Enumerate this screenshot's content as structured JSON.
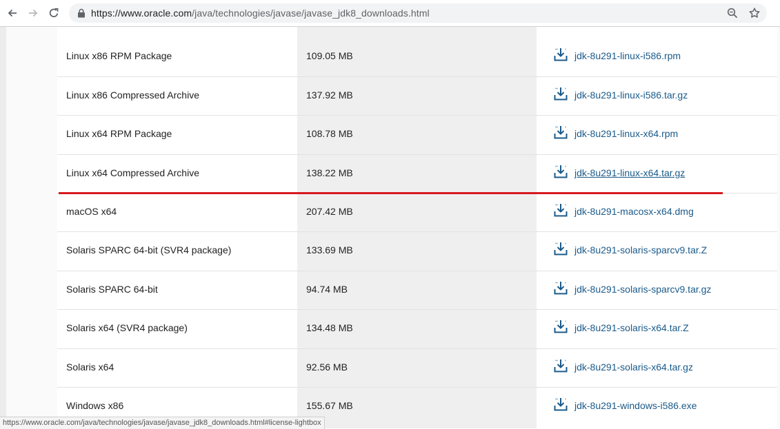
{
  "browser": {
    "url_host": "https://www.oracle.com",
    "url_path": "/java/technologies/javase/javase_jdk8_downloads.html"
  },
  "table": {
    "rows": [
      {
        "description": "Linux x86 RPM Package",
        "size": "109.05 MB",
        "file": "jdk-8u291-linux-i586.rpm"
      },
      {
        "description": "Linux x86 Compressed Archive",
        "size": "137.92 MB",
        "file": "jdk-8u291-linux-i586.tar.gz"
      },
      {
        "description": "Linux x64 RPM Package",
        "size": "108.78 MB",
        "file": "jdk-8u291-linux-x64.rpm"
      },
      {
        "description": "Linux x64 Compressed Archive",
        "size": "138.22 MB",
        "file": "jdk-8u291-linux-x64.tar.gz"
      },
      {
        "description": "macOS x64",
        "size": "207.42 MB",
        "file": "jdk-8u291-macosx-x64.dmg"
      },
      {
        "description": "Solaris SPARC 64-bit (SVR4 package)",
        "size": "133.69 MB",
        "file": "jdk-8u291-solaris-sparcv9.tar.Z"
      },
      {
        "description": "Solaris SPARC 64-bit",
        "size": "94.74 MB",
        "file": "jdk-8u291-solaris-sparcv9.tar.gz"
      },
      {
        "description": "Solaris x64 (SVR4 package)",
        "size": "134.48 MB",
        "file": "jdk-8u291-solaris-x64.tar.Z"
      },
      {
        "description": "Solaris x64",
        "size": "92.56 MB",
        "file": "jdk-8u291-solaris-x64.tar.gz"
      },
      {
        "description": "Windows x86",
        "size": "155.67 MB",
        "file": "jdk-8u291-windows-i586.exe"
      }
    ]
  },
  "status_bar": {
    "text": "https://www.oracle.com/java/technologies/javase/javase_jdk8_downloads.html#license-lightbox"
  },
  "colors": {
    "link": "#1a5a8a",
    "highlight_line": "#d71920",
    "size_column_bg": "#efefef"
  },
  "icons": {
    "back": "arrow-left-icon",
    "forward": "arrow-right-icon",
    "reload": "reload-icon",
    "lock": "lock-icon",
    "zoom": "zoom-icon",
    "bookmark": "star-icon",
    "download": "download-icon"
  }
}
